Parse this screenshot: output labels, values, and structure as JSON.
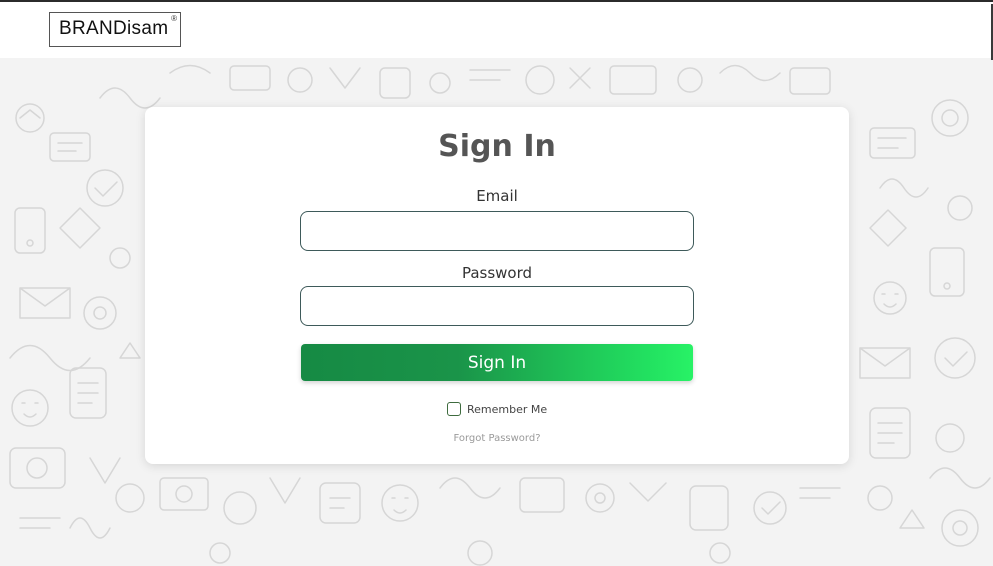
{
  "brand": {
    "name": "BRANDisam",
    "registered_mark": "®"
  },
  "login": {
    "title": "Sign In",
    "email_label": "Email",
    "email_value": "",
    "password_label": "Password",
    "password_value": "",
    "submit_label": "Sign In",
    "remember_label": "Remember Me",
    "remember_checked": false,
    "forgot_label": "Forgot Password?"
  },
  "colors": {
    "button_gradient_start": "#168a44",
    "button_gradient_end": "#28f266",
    "title": "#555555",
    "input_border": "#3e5a5a",
    "background": "#f3f3f3"
  }
}
